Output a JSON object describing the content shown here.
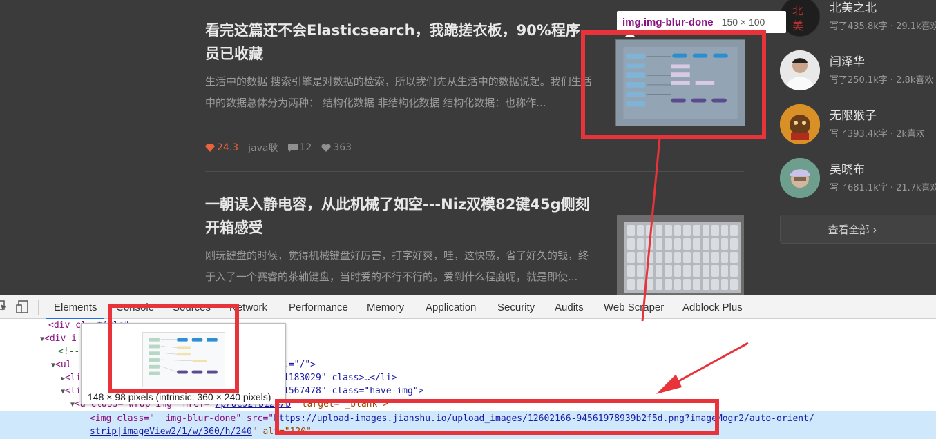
{
  "articles": [
    {
      "title": "看完这篇还不会Elasticsearch，我跪搓衣板，90%程序员已收藏",
      "abstract": "生活中的数据 搜索引擎是对数据的检索，所以我们先从生活中的数据说起。我们生活中的数据总体分为两种： 结构化数据 非结构化数据 结构化数据：也称作...",
      "hot": "24.3",
      "author": "java耿",
      "comments": "12",
      "likes": "363"
    },
    {
      "title": "一朝误入静电容，从此机械了如空---Niz双模82键45g侧刻开箱感受",
      "abstract": "刚玩键盘的时候，觉得机械键盘好厉害，打字好爽，哇，这快感，省了好久的钱，终于入了一个赛睿的茶轴键盘，当时爱的不行不行的。爱到什么程度呢，就是即使..."
    }
  ],
  "element_tooltip": {
    "selector": "img.img-blur-done",
    "size": "150 × 100"
  },
  "authors": [
    {
      "name": "北美之北",
      "info": "写了435.8k字 · 29.1k喜欢"
    },
    {
      "name": "闫泽华",
      "info": "写了250.1k字 · 2.8k喜欢"
    },
    {
      "name": "无限猴子",
      "info": "写了393.4k字 · 2k喜欢"
    },
    {
      "name": "吴晓布",
      "info": "写了681.1k字 · 21.7k喜欢"
    }
  ],
  "see_all": "查看全部 ›",
  "devtools": {
    "tabs": [
      "Elements",
      "Console",
      "Sources",
      "Network",
      "Performance",
      "Memory",
      "Application",
      "Security",
      "Audits",
      "Web Scraper",
      "Adblock Plus"
    ],
    "active_tab": "Elements",
    "code": {
      "l1_tag": "<div cl",
      "l1_rest": "..title\" ",
      "l2": "<div i",
      "l3": "<!--",
      "l4_a": "<ul",
      "l4_b": "l=\"/\">",
      "l5_a": "<li",
      "l5_b": "1183029\" class>…</li>",
      "l6_a": "<li",
      "l6_b": "1567478\" class=\"have-img\">",
      "l7_a": "<a class=\"wrap-img\" href=\"",
      "l7_href": "/p/ae92?b12b/b",
      "l7_b": "\" target=\"_blank\">",
      "l8_a": "<img class=\"  img-blur-done\" src=\"",
      "l8_src": "https://upload-images.jianshu.io/upload_images/12602166-94561978939b2f5d.png?imageMogr2/auto-orient/",
      "l9_src": "strip|imageView2/1/w/360/h/240",
      "l9_b": "\" alt=\"120\" ..."
    },
    "preview_caption": "148 × 98 pixels (intrinsic: 360 × 240 pixels)"
  }
}
